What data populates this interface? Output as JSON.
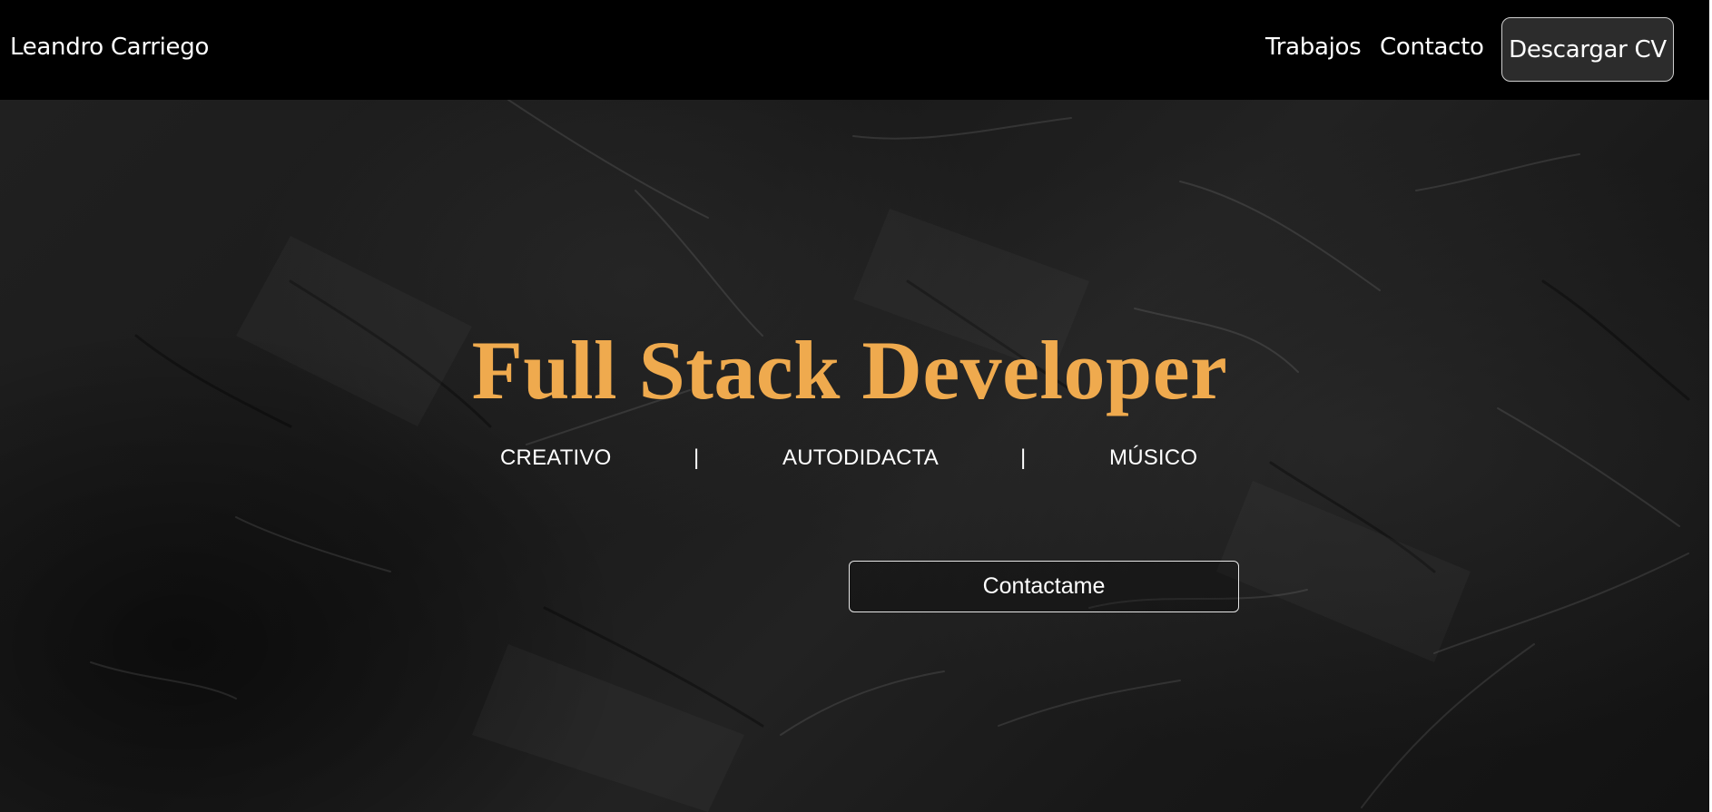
{
  "navbar": {
    "brand": "Leandro Carriego",
    "links": [
      "Trabajos",
      "Contacto"
    ],
    "cv_button": "Descargar CV"
  },
  "hero": {
    "title": "Full Stack Developer",
    "traits": [
      "CREATIVO",
      "AUTODIDACTA",
      "MÚSICO"
    ],
    "separator": "|",
    "contact_button": "Contactame"
  },
  "colors": {
    "accent": "#efaa4e",
    "navbar_bg": "#000000",
    "cv_button_bg": "#2c2c2c",
    "text": "#ffffff"
  }
}
